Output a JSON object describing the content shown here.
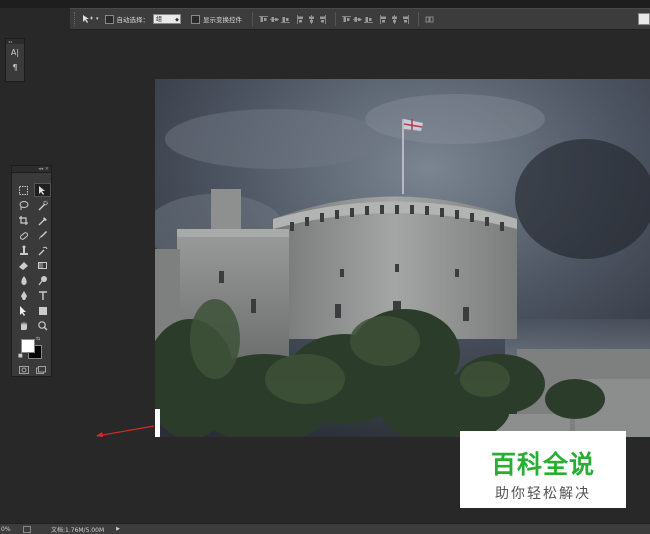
{
  "options_bar": {
    "tool_icon": "move-tool-icon",
    "auto_select_label": "自动选择：",
    "auto_select_value": "组",
    "show_transform_label": "显示变换控件",
    "align_icons": [
      "align-top-icon",
      "align-vcenter-icon",
      "align-bottom-icon",
      "align-left-icon",
      "align-hcenter-icon",
      "align-right-icon"
    ],
    "distribute_icons": [
      "distribute-top-icon",
      "distribute-vcenter-icon",
      "distribute-bottom-icon",
      "distribute-left-icon",
      "distribute-hcenter-icon",
      "distribute-right-icon"
    ]
  },
  "mini_panel": {
    "items": [
      {
        "icon": "character-panel-icon",
        "glyph": "A|"
      },
      {
        "icon": "paragraph-panel-icon",
        "glyph": "¶"
      }
    ]
  },
  "toolbox": {
    "tools": [
      {
        "name": "marquee-tool",
        "active": false
      },
      {
        "name": "move-tool",
        "active": true
      },
      {
        "name": "lasso-tool",
        "active": false
      },
      {
        "name": "quick-select-tool",
        "active": false
      },
      {
        "name": "crop-tool",
        "active": false
      },
      {
        "name": "eyedropper-tool",
        "active": false
      },
      {
        "name": "healing-brush-tool",
        "active": false
      },
      {
        "name": "brush-tool",
        "active": false
      },
      {
        "name": "clone-stamp-tool",
        "active": false
      },
      {
        "name": "history-brush-tool",
        "active": false
      },
      {
        "name": "eraser-tool",
        "active": false
      },
      {
        "name": "gradient-tool",
        "active": false
      },
      {
        "name": "blur-tool",
        "active": false
      },
      {
        "name": "dodge-tool",
        "active": false
      },
      {
        "name": "pen-tool",
        "active": false
      },
      {
        "name": "type-tool",
        "active": false
      },
      {
        "name": "path-select-tool",
        "active": false
      },
      {
        "name": "shape-tool",
        "active": false
      },
      {
        "name": "hand-tool",
        "active": false
      },
      {
        "name": "zoom-tool",
        "active": false
      }
    ],
    "foreground_color": "#ffffff",
    "background_color": "#000000"
  },
  "watermark": {
    "title": "百科全说",
    "subtitle": "助你轻松解决",
    "title_color": "#27ae33"
  },
  "status_bar": {
    "zoom": "0%",
    "doc_info": "文档:1.76M/5.00M",
    "more_icon": "▶"
  },
  "colors": {
    "workspace": "#282828",
    "panel": "#3a3a3a",
    "arrow": "#d42a2a"
  }
}
